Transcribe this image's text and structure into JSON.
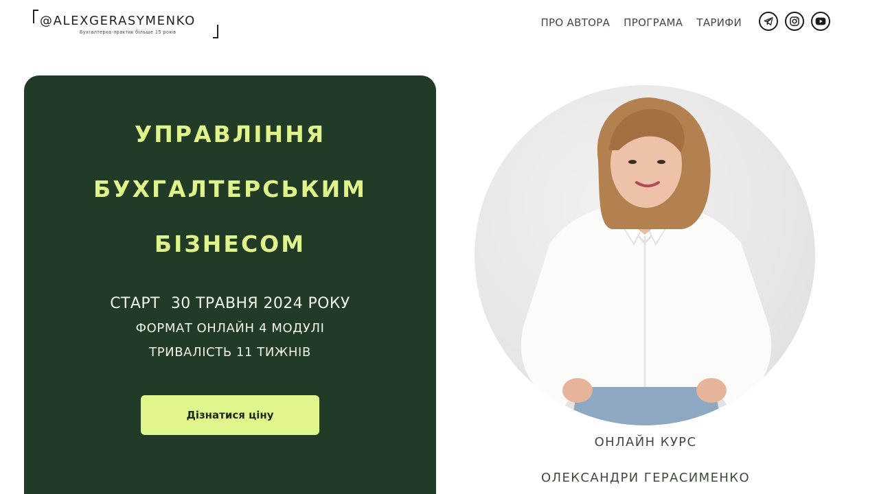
{
  "brand": {
    "title": "@ALEXGERASYMENKO",
    "subtitle": "Бухгалтерка-практик більше 15 років"
  },
  "nav": {
    "items": [
      "ПРО АВТОРА",
      "ПРОГРАМА",
      "ТАРИФИ"
    ]
  },
  "socials": {
    "icons": [
      "telegram-icon",
      "instagram-icon",
      "youtube-icon"
    ]
  },
  "hero": {
    "title_lines": [
      "УПРАВЛІННЯ",
      "БУХГАЛТЕРСЬКИМ",
      "БІЗНЕСОМ"
    ],
    "start": {
      "label": "СТАРТ",
      "value": "30 ТРАВНЯ 2024 РОКУ"
    },
    "format": {
      "label": "ФОРМАТ",
      "value": "ОНЛАЙН 4 МОДУЛІ"
    },
    "duration": {
      "label": "ТРИВАЛІСТЬ",
      "value": "11 ТИЖНІВ"
    },
    "cta_label": "Дізнатися ціну"
  },
  "author": {
    "caption_line1": "ОНЛАЙН КУРС",
    "caption_line2": "ОЛЕКСАНДРИ ГЕРАСИМЕНКО"
  },
  "colors": {
    "card_bg": "#213b27",
    "accent": "#dff48a",
    "nav_text": "#3f4a3c"
  }
}
